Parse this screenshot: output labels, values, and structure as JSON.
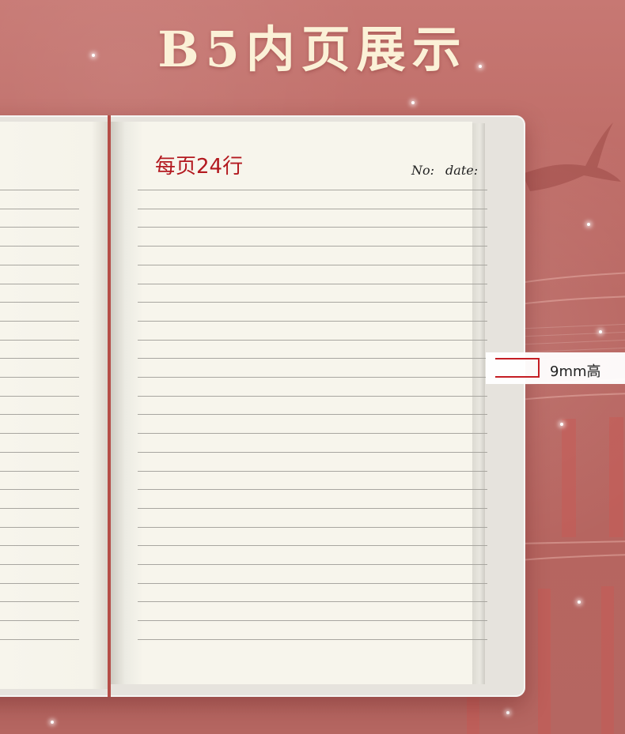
{
  "heading": {
    "title": "B5内页展示"
  },
  "notebook": {
    "lines_label": "每页24行",
    "no_label": "No:",
    "date_label": "date:",
    "ruled_lines": 25
  },
  "callout": {
    "height_label": "9mm高"
  },
  "colors": {
    "background": "#b86a66",
    "title": "#fbf1d7",
    "accent_red": "#b3191f",
    "paper": "#f7f5ec",
    "rule": "#a8a6a0"
  },
  "icons": {
    "crane": "crane-icon",
    "palace": "palace-icon",
    "star": "star-icon"
  }
}
